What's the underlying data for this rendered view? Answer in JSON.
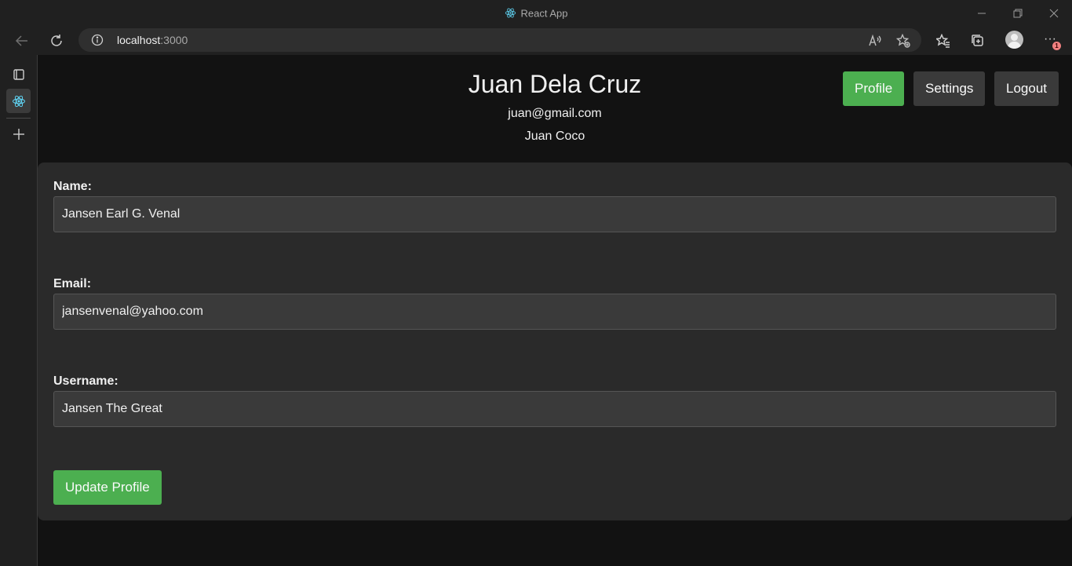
{
  "browser": {
    "tab_title": "React App",
    "url_host": "localhost",
    "url_port": ":3000",
    "notification_count": "1"
  },
  "header": {
    "name": "Juan Dela Cruz",
    "email": "juan@gmail.com",
    "username": "Juan Coco"
  },
  "nav": {
    "profile_label": "Profile",
    "settings_label": "Settings",
    "logout_label": "Logout"
  },
  "form": {
    "name_label": "Name:",
    "name_value": "Jansen Earl G. Venal",
    "email_label": "Email:",
    "email_value": "jansenvenal@yahoo.com",
    "username_label": "Username:",
    "username_value": "Jansen The Great",
    "submit_label": "Update Profile"
  },
  "colors": {
    "accent": "#4caf50",
    "page_bg": "#121212",
    "card_bg": "#2a2a2a"
  }
}
